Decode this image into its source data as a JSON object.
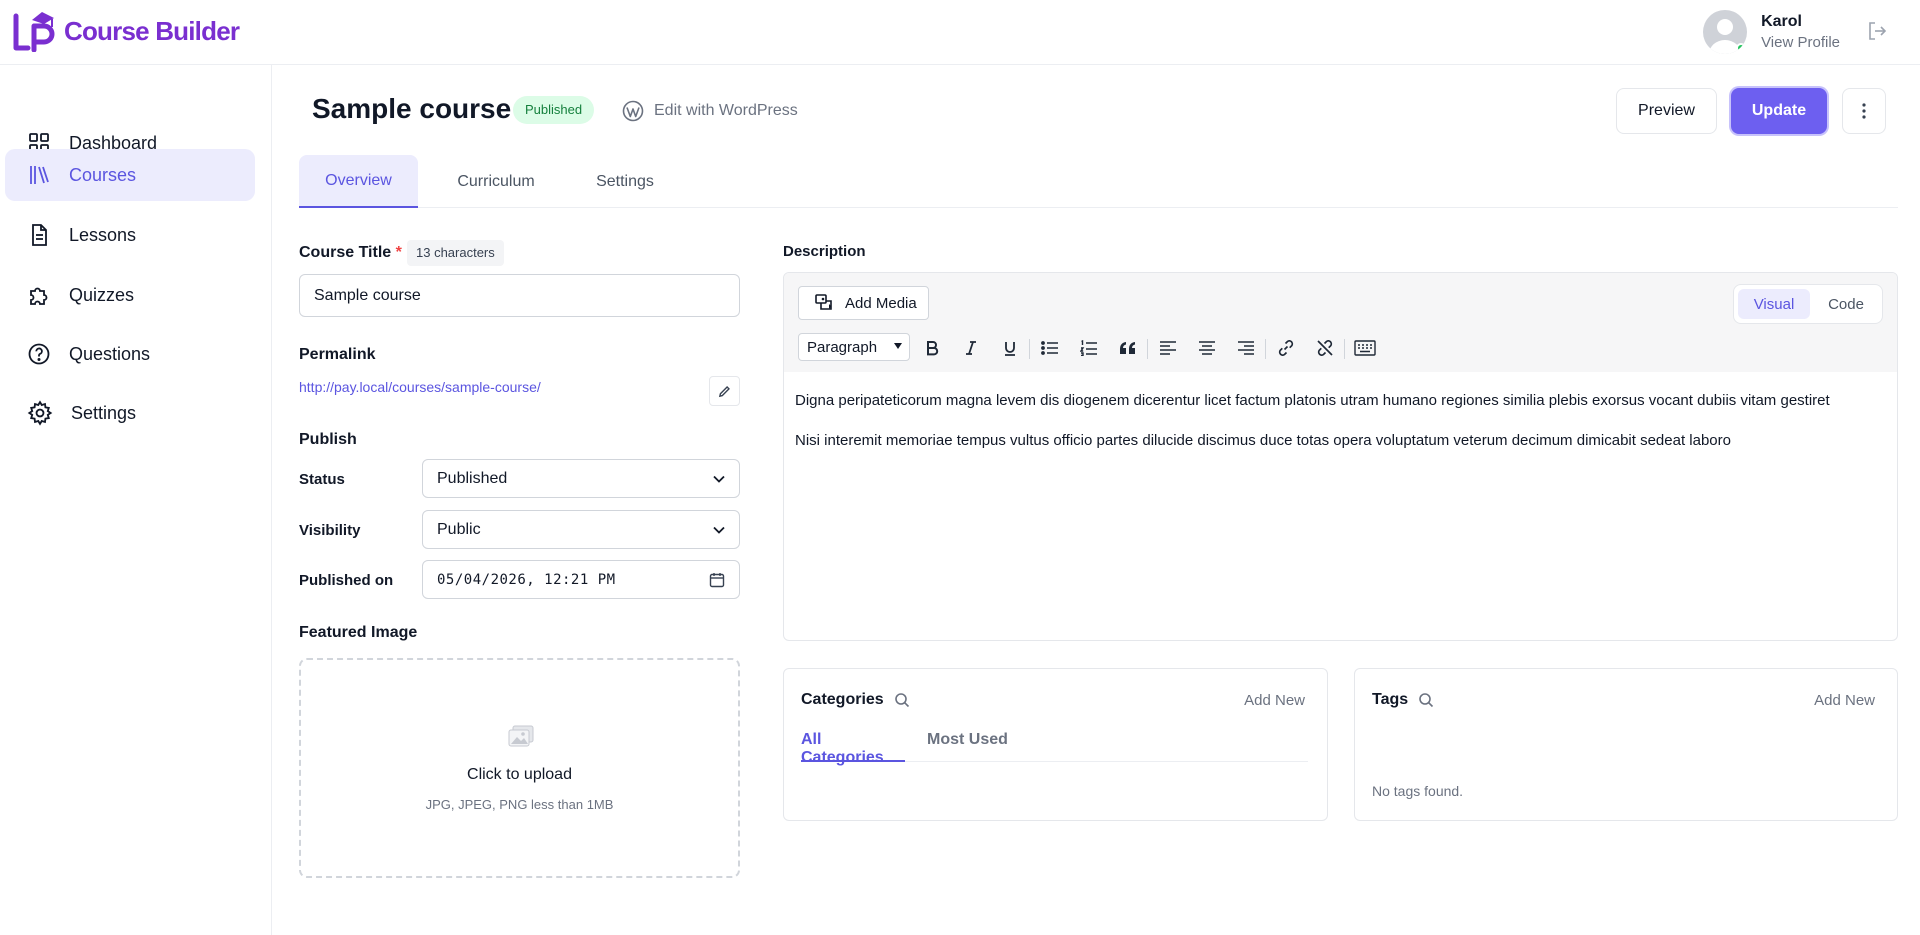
{
  "app": {
    "name": "Course Builder",
    "brand_color": "#7a2fd0",
    "accent_color": "#5b55e0"
  },
  "user": {
    "name": "Karol",
    "link": "View Profile",
    "status": "online"
  },
  "sidebar": {
    "items": [
      {
        "label": "Dashboard",
        "icon": "grid-icon"
      },
      {
        "label": "Courses",
        "icon": "books-icon",
        "active": true
      },
      {
        "label": "Lessons",
        "icon": "document-icon"
      },
      {
        "label": "Quizzes",
        "icon": "puzzle-icon"
      },
      {
        "label": "Questions",
        "icon": "question-circle-icon"
      },
      {
        "label": "Settings",
        "icon": "gear-icon"
      }
    ]
  },
  "header": {
    "title": "Sample course",
    "status_badge": "Published",
    "wp_link": "Edit with WordPress",
    "preview_label": "Preview",
    "update_label": "Update"
  },
  "tabs": [
    {
      "label": "Overview",
      "active": true
    },
    {
      "label": "Curriculum"
    },
    {
      "label": "Settings"
    }
  ],
  "form": {
    "course_title_label": "Course Title",
    "required_mark": "*",
    "char_count": "13 characters",
    "course_title_value": "Sample course",
    "permalink_label": "Permalink",
    "permalink_url": "http://pay.local/courses/sample-course/",
    "publish_label": "Publish",
    "status_label": "Status",
    "status_value": "Published",
    "visibility_label": "Visibility",
    "visibility_value": "Public",
    "published_on_label": "Published on",
    "published_on_value": "05/04/2026, 12:21 PM",
    "featured_image_label": "Featured Image",
    "upload_label": "Click to upload",
    "upload_hint": "JPG, JPEG, PNG less than 1MB"
  },
  "editor": {
    "label": "Description",
    "add_media": "Add Media",
    "mode_visual": "Visual",
    "mode_code": "Code",
    "format_select": "Paragraph",
    "paragraphs": [
      "Digna peripateticorum magna levem dis diogenem dicerentur licet factum platonis utram humano regiones similia plebis exorsus vocant dubiis vitam gestiret",
      "Nisi interemit memoriae tempus vultus officio partes dilucide discimus duce totas opera voluptatum veterum decimum dimicabit sedeat laboro"
    ]
  },
  "categories": {
    "title": "Categories",
    "add_new": "Add New",
    "tab_all": "All Categories",
    "tab_most_used": "Most Used"
  },
  "tags": {
    "title": "Tags",
    "add_new": "Add New",
    "empty": "No tags found."
  }
}
